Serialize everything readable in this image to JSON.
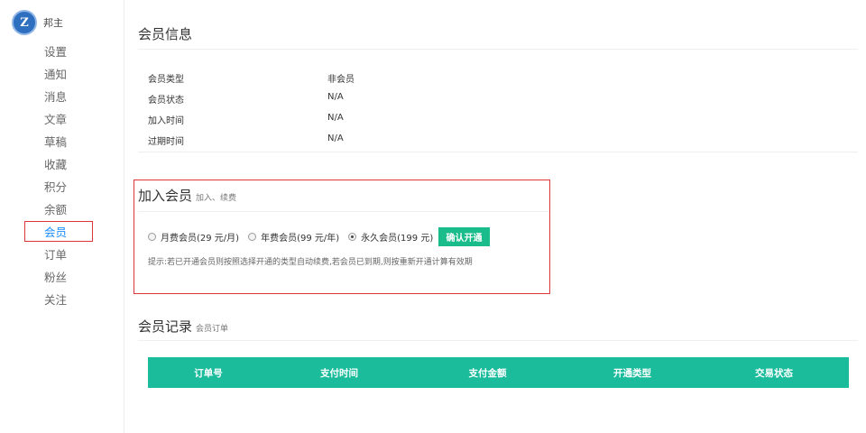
{
  "user": {
    "avatar_letter": "Z",
    "name": "邦主"
  },
  "sidebar": {
    "items": [
      {
        "label": "设置"
      },
      {
        "label": "通知"
      },
      {
        "label": "消息"
      },
      {
        "label": "文章"
      },
      {
        "label": "草稿"
      },
      {
        "label": "收藏"
      },
      {
        "label": "积分"
      },
      {
        "label": "余额"
      },
      {
        "label": "会员"
      },
      {
        "label": "订单"
      },
      {
        "label": "粉丝"
      },
      {
        "label": "关注"
      }
    ],
    "active": "会员"
  },
  "member_info": {
    "title": "会员信息",
    "rows": [
      {
        "label": "会员类型",
        "value": "非会员"
      },
      {
        "label": "会员状态",
        "value": "N/A"
      },
      {
        "label": "加入时间",
        "value": "N/A"
      },
      {
        "label": "过期时间",
        "value": "N/A"
      }
    ]
  },
  "join": {
    "title": "加入会员",
    "subtitle": "加入、续费",
    "options": [
      {
        "label": "月费会员(29 元/月)",
        "selected": false
      },
      {
        "label": "年费会员(99 元/年)",
        "selected": false
      },
      {
        "label": "永久会员(199 元)",
        "selected": true
      }
    ],
    "confirm_label": "确认开通",
    "hint": "提示:若已开通会员则按照选择开通的类型自动续费,若会员已到期,则按重新开通计算有效期"
  },
  "records": {
    "title": "会员记录",
    "subtitle": "会员订单",
    "columns": [
      "订单号",
      "支付时间",
      "支付金额",
      "开通类型",
      "交易状态"
    ]
  },
  "colors": {
    "accent": "#1abc9c",
    "highlight": "#e0363a",
    "active_link": "#1a8cff"
  }
}
